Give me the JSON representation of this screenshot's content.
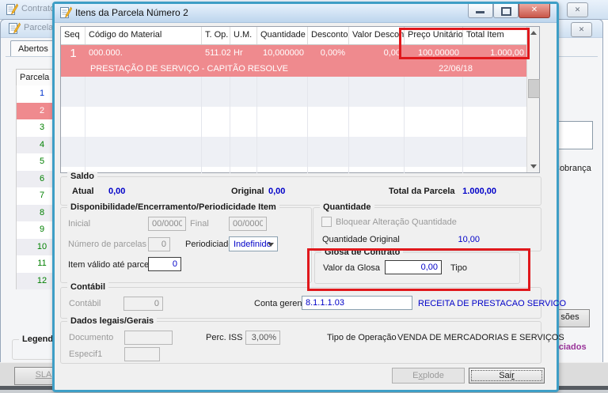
{
  "colors": {
    "annotation_red": "#e0181c",
    "selected_pink": "#ef8a8e",
    "value_blue": "#0000c8",
    "parcela_green": "#008000",
    "parcela_blue": "#0033cc",
    "link_purple": "#993399",
    "dialog_border_teal": "#3e9ec6"
  },
  "background": {
    "contratos": {
      "title": "Contratos"
    },
    "parcelas": {
      "title": "Parcelas do",
      "tab": "Abertos",
      "column_header": "Parcela",
      "rows": [
        "1",
        "2",
        "3",
        "4",
        "5",
        "6",
        "7",
        "8",
        "9",
        "10",
        "11",
        "12"
      ],
      "legenda": "Legenda",
      "sla": "SLA"
    },
    "right_panel": {
      "cobranca": "Cobrança",
      "previsoes_partial": "sões",
      "associados_partial": "ociados"
    }
  },
  "dialog": {
    "title": "Itens da Parcela Número 2",
    "grid": {
      "columns": [
        "Seq",
        "Código do Material",
        "T. Op.",
        "U.M.",
        "Quantidade",
        "Desconto",
        "Valor Desconto",
        "Preço Unitário",
        "Total Item"
      ],
      "row": {
        "seq": "1",
        "codigo": "000.000.",
        "t_op": "511.02",
        "um": "Hr",
        "quantidade": "10,000000",
        "desconto": "0,00%",
        "valor_desconto": "0,00",
        "preco_unitario": "100,00000",
        "total_item": "1.000,00",
        "descricao": "PRESTAÇÃO DE SERVIÇO - CAPITÃO RESOLVE",
        "data": "22/06/18"
      }
    },
    "saldo": {
      "legend": "Saldo",
      "atual_label": "Atual",
      "atual_value": "0,00",
      "original_label": "Original",
      "original_value": "0,00",
      "total_label": "Total da Parcela",
      "total_value": "1.000,00"
    },
    "disponibilidade": {
      "legend": "Disponibilidade/Encerramento/Periodicidade Item",
      "inicial_label": "Inicial",
      "inicial_value": "00/0000",
      "final_label": "Final",
      "final_value": "00/0000",
      "num_parcelas_label": "Número de parcelas",
      "num_parcelas_value": "0",
      "periodicidade_label": "Periodiciade",
      "periodicidade_value": "Indefinido",
      "item_valido_label": "Item válido até parcela",
      "item_valido_value": "0"
    },
    "quantidade": {
      "legend": "Quantidade",
      "bloquear_label": "Bloquear Alteração Quantidade",
      "original_label": "Quantidade Original",
      "original_value": "10,00"
    },
    "glosa": {
      "legend": "Glosa de Contrato",
      "valor_label": "Valor da Glosa",
      "valor_value": "0,00",
      "tipo_label": "Tipo"
    },
    "contabil": {
      "legend": "Contábil",
      "contabil_label": "Contábil",
      "contabil_value": "0",
      "conta_label": "Conta gerencial",
      "conta_value": "8.1.1.1.03",
      "conta_desc": "RECEITA DE PRESTACAO SERVICO"
    },
    "dados_legais": {
      "legend": "Dados legais/Gerais",
      "documento_label": "Documento",
      "perc_iss_label": "Perc. ISS",
      "perc_iss_value": "3,00%",
      "tipo_operacao_label": "Tipo de Operação",
      "tipo_operacao_value": "VENDA DE MERCADORIAS E SERVIÇOS",
      "especif_label": "Especif1"
    },
    "buttons": {
      "explode_pre": "E",
      "explode_u": "x",
      "explode_post": "plode",
      "sair_pre": "Sai",
      "sair_u": "r",
      "sair_post": ""
    }
  }
}
